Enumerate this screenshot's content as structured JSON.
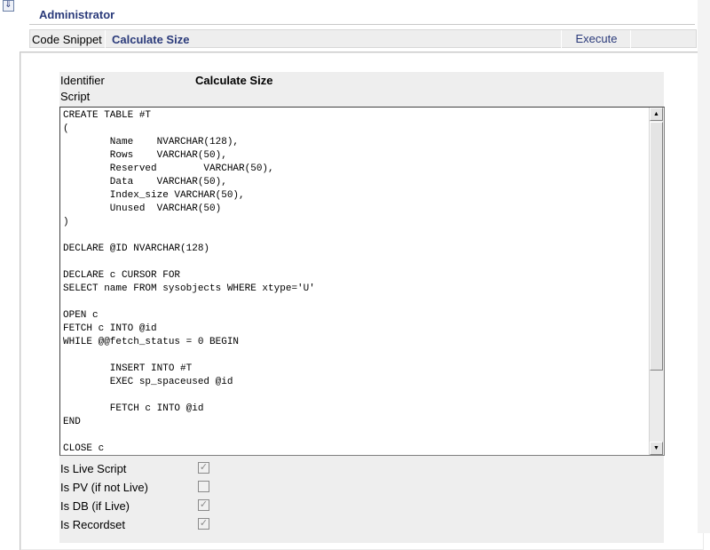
{
  "header": {
    "title": "Administrator"
  },
  "tabbar": {
    "section_label": "Code Snippet",
    "snippet_title": "Calculate Size",
    "execute_label": "Execute"
  },
  "form": {
    "identifier_label": "Identifier",
    "identifier_value": "Calculate Size",
    "script_label": "Script",
    "script": "CREATE TABLE #T\n(\n        Name    NVARCHAR(128),\n        Rows    VARCHAR(50),\n        Reserved        VARCHAR(50),\n        Data    VARCHAR(50),\n        Index_size VARCHAR(50),\n        Unused  VARCHAR(50)\n)\n\nDECLARE @ID NVARCHAR(128)\n\nDECLARE c CURSOR FOR\nSELECT name FROM sysobjects WHERE xtype='U'\n\nOPEN c\nFETCH c INTO @id\nWHILE @@fetch_status = 0 BEGIN\n\n        INSERT INTO #T\n        EXEC sp_spaceused @id\n\n        FETCH c INTO @id\nEND\n\nCLOSE c",
    "options": [
      {
        "label": "Is Live Script",
        "checked": true
      },
      {
        "label": "Is PV (if not Live)",
        "checked": false
      },
      {
        "label": "Is DB (if Live)",
        "checked": true
      },
      {
        "label": "Is Recordset",
        "checked": true
      }
    ]
  },
  "icons": {
    "collapse": "double-chevron-down-icon",
    "scroll_up": "arrow-up-icon",
    "scroll_down": "arrow-down-icon"
  }
}
